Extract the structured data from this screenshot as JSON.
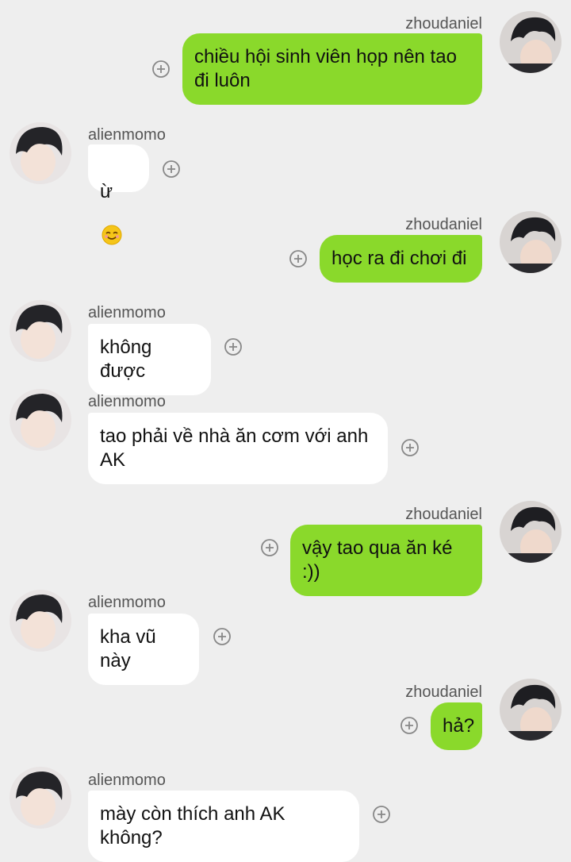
{
  "colors": {
    "background": "#eeeeee",
    "outgoing_bubble": "#8ad92b",
    "incoming_bubble": "#ffffff",
    "username": "#555555"
  },
  "messages": [
    {
      "sender": "zhoudaniel",
      "direction": "outgoing",
      "text": "chiều hội sinh viên họp nên tao\nđi luôn",
      "avatar_icon": "user-avatar-icon",
      "action_icon": "add-circle-icon"
    },
    {
      "sender": "alienmomo",
      "direction": "incoming",
      "text": "ừ",
      "emoji": "smiling-face-emoji",
      "avatar_icon": "user-avatar-icon",
      "action_icon": "add-circle-icon"
    },
    {
      "sender": "zhoudaniel",
      "direction": "outgoing",
      "text": "học ra đi chơi đi",
      "avatar_icon": "user-avatar-icon",
      "action_icon": "add-circle-icon"
    },
    {
      "sender": "alienmomo",
      "direction": "incoming",
      "text": "không được",
      "avatar_icon": "user-avatar-icon",
      "action_icon": "add-circle-icon"
    },
    {
      "sender": "alienmomo",
      "direction": "incoming",
      "text": "tao phải về nhà ăn cơm với anh\nAK",
      "avatar_icon": "user-avatar-icon",
      "action_icon": "add-circle-icon"
    },
    {
      "sender": "zhoudaniel",
      "direction": "outgoing",
      "text": "vậy tao qua ăn ké :))",
      "avatar_icon": "user-avatar-icon",
      "action_icon": "add-circle-icon"
    },
    {
      "sender": "alienmomo",
      "direction": "incoming",
      "text": "kha vũ này",
      "avatar_icon": "user-avatar-icon",
      "action_icon": "add-circle-icon"
    },
    {
      "sender": "zhoudaniel",
      "direction": "outgoing",
      "text": "hả?",
      "avatar_icon": "user-avatar-icon",
      "action_icon": "add-circle-icon"
    },
    {
      "sender": "alienmomo",
      "direction": "incoming",
      "text": "mày còn thích anh AK không?",
      "avatar_icon": "user-avatar-icon",
      "action_icon": "add-circle-icon"
    }
  ]
}
